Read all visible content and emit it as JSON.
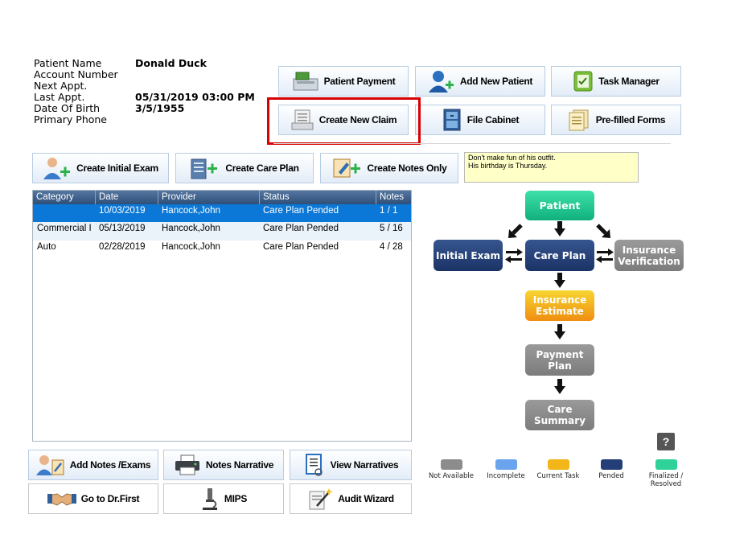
{
  "patient": {
    "name_label": "Patient Name",
    "name_value": "Donald Duck",
    "account_label": "Account Number",
    "account_value": "",
    "next_appt_label": "Next Appt.",
    "next_appt_value": "",
    "last_appt_label": "Last Appt.",
    "last_appt_value": "05/31/2019 03:00 PM",
    "dob_label": "Date Of Birth",
    "dob_value": "3/5/1955",
    "phone_label": "Primary Phone",
    "phone_value": ""
  },
  "top_buttons": {
    "patient_payment": "Patient Payment",
    "add_new_patient": "Add New Patient",
    "task_manager": "Task Manager",
    "create_new_claim": "Create New Claim",
    "file_cabinet": "File Cabinet",
    "prefilled_forms": "Pre-filled Forms"
  },
  "action_buttons": {
    "create_initial_exam": "Create Initial Exam",
    "create_care_plan": "Create Care Plan",
    "create_notes_only": "Create Notes Only"
  },
  "note": {
    "line1": "Don't make fun of his outfit.",
    "line2": "His birthday is Thursday."
  },
  "table": {
    "headers": [
      "Category",
      "Date",
      "Provider",
      "Status",
      "Notes"
    ],
    "rows": [
      [
        "",
        "10/03/2019",
        "Hancock,John",
        "Care Plan Pended",
        "1 / 1"
      ],
      [
        "Commercial I",
        "05/13/2019",
        "Hancock,John",
        "Care Plan Pended",
        "5 / 16"
      ],
      [
        "Auto",
        "02/28/2019",
        "Hancock,John",
        "Care Plan Pended",
        "4 / 28"
      ]
    ]
  },
  "flow": {
    "patient": "Patient",
    "initial_exam": "Initial Exam",
    "care_plan": "Care Plan",
    "insurance_verification": "Insurance Verification",
    "insurance_estimate": "Insurance Estimate",
    "payment_plan": "Payment Plan",
    "care_summary": "Care Summary"
  },
  "bottom_buttons": {
    "add_notes_exams": "Add Notes /Exams",
    "notes_narrative": "Notes Narrative",
    "view_narratives": "View Narratives",
    "go_to_drfirst": "Go to Dr.First",
    "mips": "MIPS",
    "audit_wizard": "Audit Wizard"
  },
  "help": "?",
  "legend": {
    "not_available": "Not Available",
    "incomplete": "Incomplete",
    "current_task": "Current Task",
    "pended": "Pended",
    "finalized": "Finalized / Resolved"
  },
  "colors": {
    "not_available": "#8c8c8c",
    "incomplete": "#6aa4ec",
    "current_task": "#f2b619",
    "pended": "#243e78",
    "finalized": "#2fd39a",
    "selection": "#0b78d7",
    "highlight": "#d80000"
  }
}
